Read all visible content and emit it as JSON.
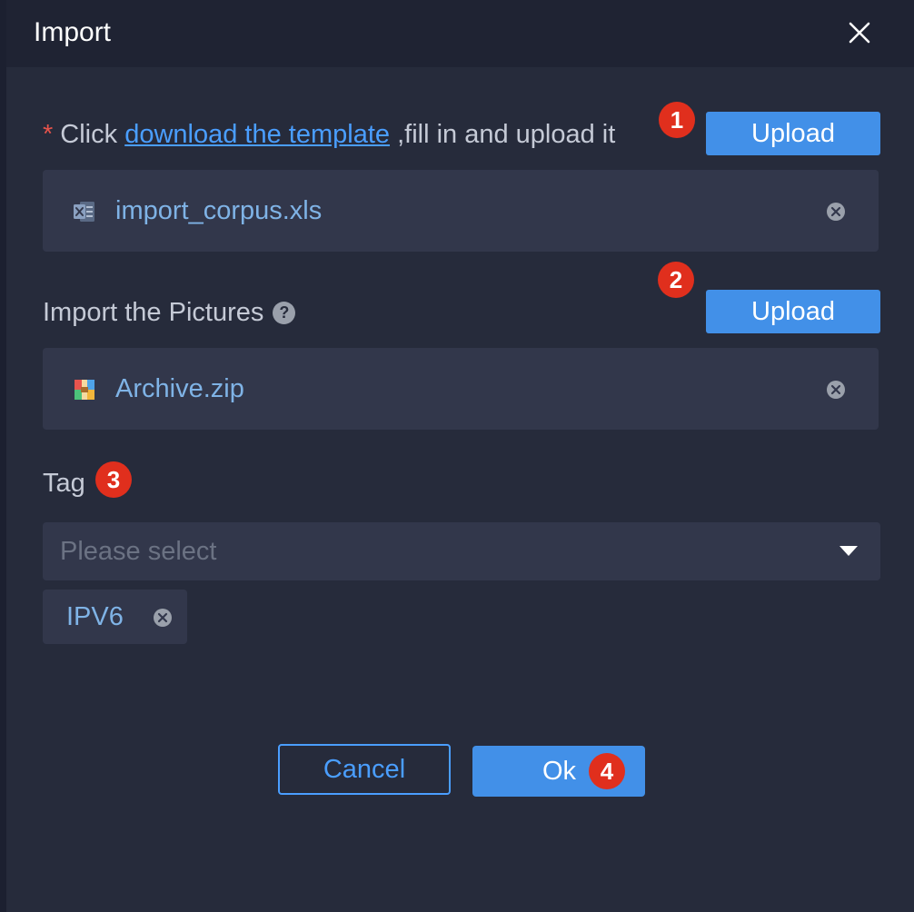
{
  "dialog": {
    "title": "Import",
    "close_icon": "close-icon"
  },
  "template_section": {
    "required_mark": "*",
    "prefix": "Click",
    "link_text": "download the template",
    "suffix": ",fill in and upload it",
    "upload_label": "Upload",
    "badge": "1",
    "file": {
      "icon": "excel-file-icon",
      "name": "import_corpus.xls",
      "remove_icon": "remove-circle-icon"
    }
  },
  "pictures_section": {
    "label": "Import the Pictures",
    "help_icon": "?",
    "upload_label": "Upload",
    "badge": "2",
    "file": {
      "icon": "zip-archive-icon",
      "name": "Archive.zip",
      "remove_icon": "remove-circle-icon"
    }
  },
  "tag_section": {
    "label": "Tag",
    "badge": "3",
    "select_placeholder": "Please select",
    "tags": [
      {
        "label": "IPV6"
      }
    ]
  },
  "footer": {
    "cancel_label": "Cancel",
    "ok_label": "Ok",
    "ok_badge": "4"
  },
  "colors": {
    "background": "#262b3b",
    "header": "#1f2333",
    "primary": "#4290e8",
    "link": "#4a9eff",
    "badge": "#e02f1d",
    "required": "#e5534b",
    "file_text": "#7fb3e6"
  }
}
